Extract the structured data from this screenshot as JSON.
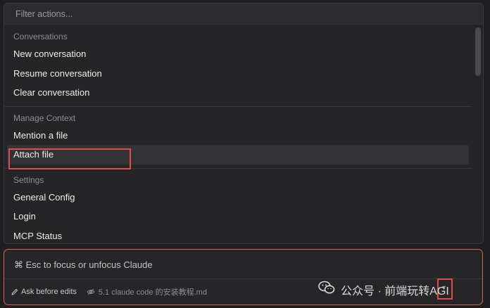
{
  "filter": {
    "placeholder": "Filter actions..."
  },
  "sections": [
    {
      "header": "Conversations",
      "items": [
        "New conversation",
        "Resume conversation",
        "Clear conversation"
      ]
    },
    {
      "header": "Manage Context",
      "items": [
        "Mention a file",
        "Attach file"
      ]
    },
    {
      "header": "Settings",
      "items": [
        "General Config",
        "Login",
        "MCP Status"
      ]
    }
  ],
  "selected_item": "Attach file",
  "input": {
    "hint": "⌘ Esc to focus or unfocus Claude",
    "mode_label": "Ask before edits",
    "file_label": "5.1 claude code 的安装教程.md"
  },
  "watermark": {
    "text": "公众号 · 前端玩转AGI"
  },
  "colors": {
    "accent_border": "#c96b52",
    "highlight_red": "#e04b4b",
    "selected_bg": "#333336"
  }
}
